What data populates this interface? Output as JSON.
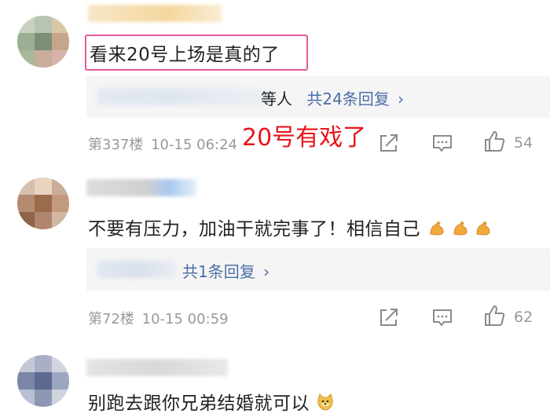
{
  "comments": [
    {
      "text": "看来20号上场是真的了",
      "reply_suffix": "等人",
      "reply_link": "共24条回复",
      "reply_chevron": "›",
      "floor": "第337楼",
      "time": "10-15 06:24",
      "likes": "54"
    },
    {
      "text": "不要有压力，加油干就完事了！相信自己",
      "reply_link": "共1条回复",
      "reply_chevron": "›",
      "floor": "第72楼",
      "time": "10-15 00:59",
      "likes": "62"
    },
    {
      "text": "别跑去跟你兄弟结婚就可以"
    }
  ],
  "annotation": "20号有戏了",
  "colors": {
    "highlight_border": "#e5589a",
    "annotation": "#e8141b",
    "link": "#4a6ea8",
    "meta": "#999999"
  },
  "icons": [
    "share-icon",
    "comment-icon",
    "like-icon",
    "flexed-arm-emoji",
    "doge-emoji"
  ]
}
